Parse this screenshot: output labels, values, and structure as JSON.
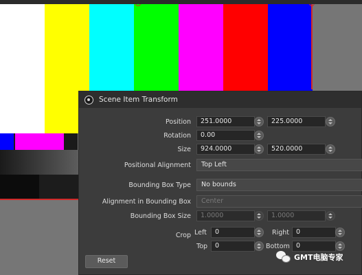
{
  "canvas": {
    "bar_colors": [
      "#ffffff",
      "#ffff00",
      "#00ffff",
      "#00ff00",
      "#ff00ff",
      "#ff0000",
      "#0000ff"
    ],
    "row2_colors": [
      "#0000ff",
      "#1a1a1a",
      "#ff00ff",
      "#1a1a1a"
    ],
    "step_colors": [
      "#0c0c0c",
      "#1c1c1c",
      "#2c2c2c",
      "#3c3c3c",
      "#4e4e4e",
      "#626262",
      "#7a7a7a",
      "#7a7a7a"
    ],
    "selection_color": "#d12a2a"
  },
  "dialog": {
    "title": "Scene Item Transform",
    "position": {
      "label": "Position",
      "x": "251.0000",
      "y": "225.0000"
    },
    "rotation": {
      "label": "Rotation",
      "value": "0.00"
    },
    "size": {
      "label": "Size",
      "width": "924.0000",
      "height": "520.0000"
    },
    "positional_alignment": {
      "label": "Positional Alignment",
      "value": "Top Left"
    },
    "bounding_box_type": {
      "label": "Bounding Box Type",
      "value": "No bounds"
    },
    "alignment_in_bounding_box": {
      "label": "Alignment in Bounding Box",
      "value": "Center"
    },
    "bounding_box_size": {
      "label": "Bounding Box Size",
      "width": "1.0000",
      "height": "1.0000"
    },
    "crop": {
      "label": "Crop",
      "left_label": "Left",
      "left": "0",
      "right_label": "Right",
      "right": "0",
      "top_label": "Top",
      "top": "0",
      "bottom_label": "Bottom",
      "bottom": "0"
    },
    "reset_label": "Reset"
  },
  "watermark": {
    "text": "GMT电脑专家"
  }
}
